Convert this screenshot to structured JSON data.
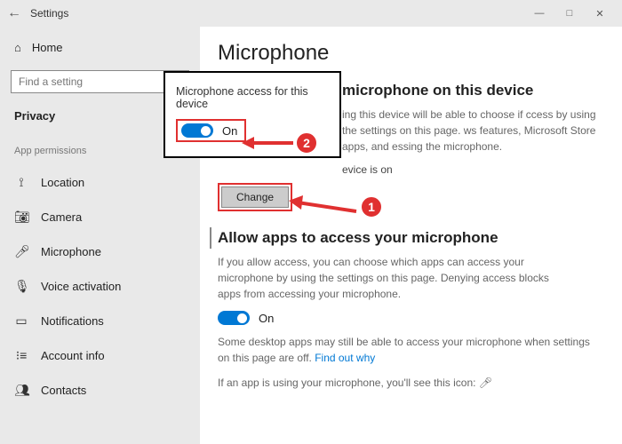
{
  "titlebar": {
    "title": "Settings"
  },
  "sidebar": {
    "home_label": "Home",
    "search_placeholder": "Find a setting",
    "privacy_label": "Privacy",
    "section_label": "App permissions",
    "items": [
      {
        "label": "Location"
      },
      {
        "label": "Camera"
      },
      {
        "label": "Microphone"
      },
      {
        "label": "Voice activation"
      },
      {
        "label": "Notifications"
      },
      {
        "label": "Account info"
      },
      {
        "label": "Contacts"
      }
    ]
  },
  "main": {
    "page_title": "Microphone",
    "section1_heading": "microphone on this device",
    "section1_body": "ing this device will be able to choose if ccess by using the settings on this page. ws features, Microsoft Store apps, and essing the microphone.",
    "status_line": "evice is on",
    "change_label": "Change",
    "section2_heading": "Allow apps to access your microphone",
    "section2_body": "If you allow access, you can choose which apps can access your microphone by using the settings on this page. Denying access blocks apps from accessing your microphone.",
    "toggle2_label": "On",
    "note_prefix": "Some desktop apps may still be able to access your microphone when settings on this page are off. ",
    "note_link": "Find out why",
    "icon_line": "If an app is using your microphone, you'll see this icon:"
  },
  "flyout": {
    "title": "Microphone access for this device",
    "toggle_label": "On"
  },
  "annotations": {
    "step1": "1",
    "step2": "2"
  }
}
